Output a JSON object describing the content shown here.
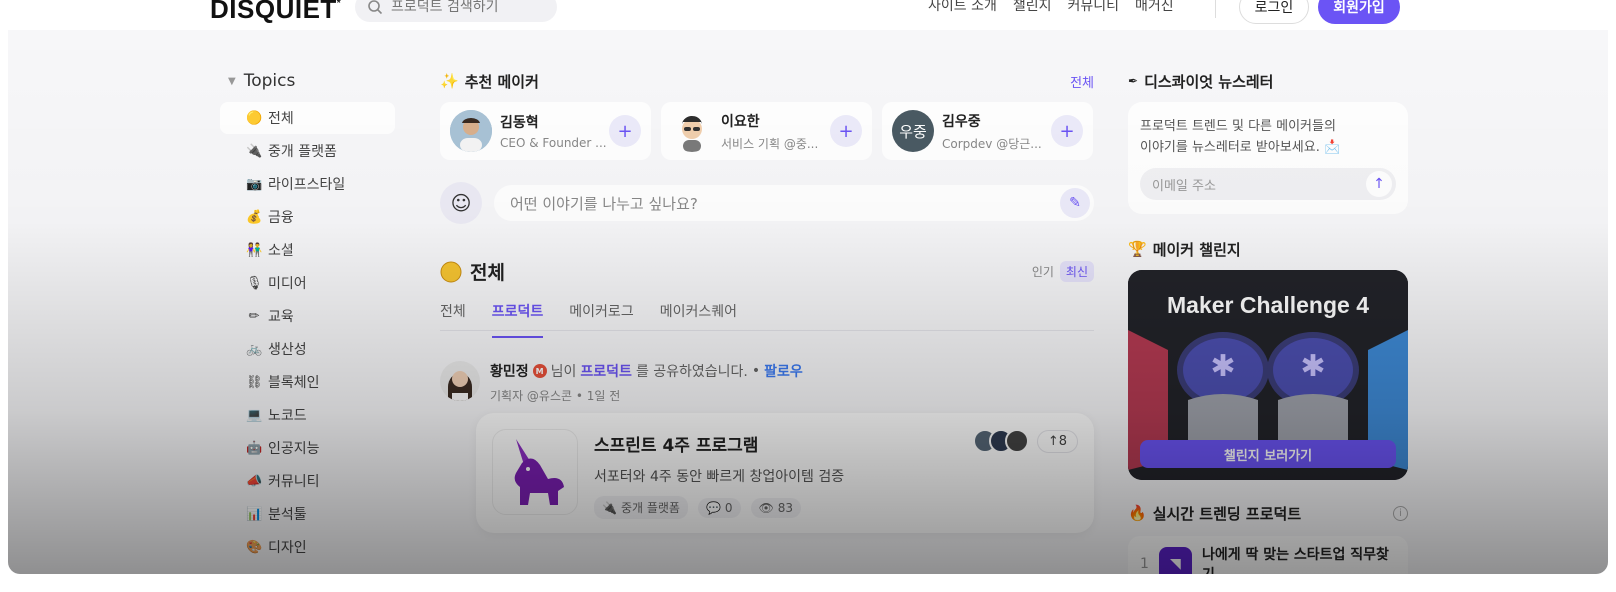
{
  "nav": {
    "logo": "DISQUIET",
    "logo_mark": "*",
    "search_placeholder": "프로덕트 검색하기",
    "links": [
      "사이트 소개",
      "챌린지",
      "커뮤니티",
      "매거진"
    ],
    "login": "로그인",
    "signup": "회원가입"
  },
  "sidebar": {
    "title": "Topics",
    "items": [
      {
        "label": "전체",
        "icon": "🟡"
      },
      {
        "label": "중개 플랫폼",
        "icon": "🔌"
      },
      {
        "label": "라이프스타일",
        "icon": "📷"
      },
      {
        "label": "금융",
        "icon": "💰"
      },
      {
        "label": "소셜",
        "icon": "👫"
      },
      {
        "label": "미디어",
        "icon": "🎙"
      },
      {
        "label": "교육",
        "icon": "✏"
      },
      {
        "label": "생산성",
        "icon": "🚲"
      },
      {
        "label": "블록체인",
        "icon": "⛓"
      },
      {
        "label": "노코드",
        "icon": "💻"
      },
      {
        "label": "인공지능",
        "icon": "🤖"
      },
      {
        "label": "커뮤니티",
        "icon": "📣"
      },
      {
        "label": "분석툴",
        "icon": "📊"
      },
      {
        "label": "디자인",
        "icon": "🎨"
      }
    ]
  },
  "makers": {
    "title": "추천 메이커",
    "see_all": "전체",
    "list": [
      {
        "name": "김동혁",
        "sub": "CEO & Founder ...",
        "avatar_color": "#8fb0c9"
      },
      {
        "name": "이요한",
        "sub": "서비스 기획 @중...",
        "avatar_color": "#ffffff"
      },
      {
        "name": "김우중",
        "sub": "Corpdev @당근...",
        "avatar_text": "우중",
        "avatar_color": "#4a5a63"
      }
    ]
  },
  "compose": {
    "placeholder": "어떤 이야기를 나누고 싶나요?"
  },
  "feed": {
    "title": "전체",
    "sort_popular": "인기",
    "sort_latest": "최신",
    "tabs": [
      "전체",
      "프로덕트",
      "메이커로그",
      "메이커스퀘어"
    ],
    "active_tab": 1,
    "post": {
      "author": "황민정",
      "badge": "M",
      "action_pre": "님이",
      "keyword": "프로덕트",
      "action_post": "를 공유하였습니다.",
      "follow": "팔로우",
      "meta": "기획자 @유스콘 • 1일 전",
      "card": {
        "title": "스프린트 4주 프로그램",
        "desc": "서포터와 4주 동안 빠르게 창업아이템 검증",
        "tag": "중개 플랫폼",
        "comments": "0",
        "views": "83",
        "upvotes": "8"
      }
    }
  },
  "newsletter": {
    "title": "디스콰이엇 뉴스레터",
    "text1": "프로덕트 트렌드 및 다른 메이커들의",
    "text2": "이야기를 뉴스레터로 받아보세요.",
    "email_placeholder": "이메일 주소"
  },
  "challenge": {
    "title": "메이커 챌린지",
    "banner_heading": "Maker Challenge 4",
    "button": "챌린지 보러가기"
  },
  "trending": {
    "title": "실시간 트렌딩 프로덕트",
    "items": [
      {
        "rank": "1",
        "name": "나에게 딱 맞는 스타트업 직무찾기"
      }
    ]
  },
  "colors": {
    "accent": "#6b54f5",
    "follow": "#3d7bf2"
  }
}
